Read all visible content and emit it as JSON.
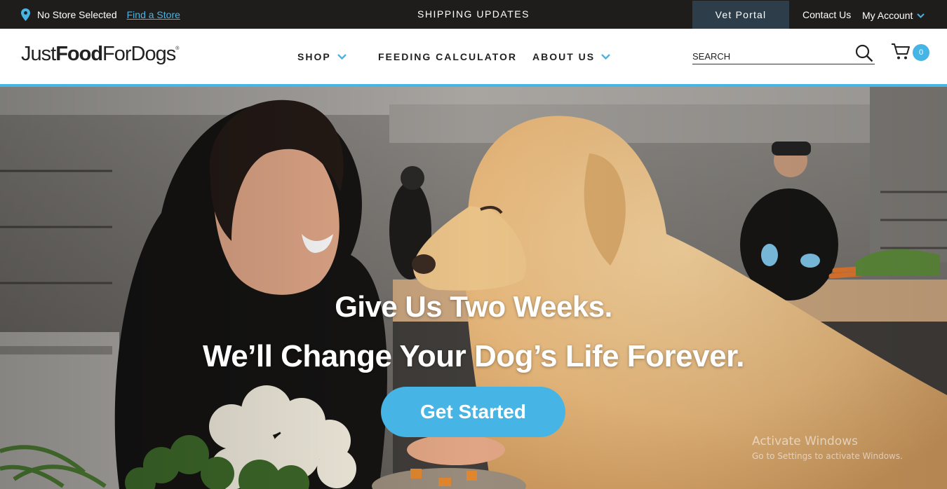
{
  "topbar": {
    "store_status": "No Store Selected",
    "find_store_link": "Find a Store",
    "shipping_updates": "SHIPPING UPDATES",
    "vet_portal": "Vet Portal",
    "contact_us": "Contact Us",
    "my_account": "My Account"
  },
  "header": {
    "logo": {
      "part1": "Just",
      "part2": "Food",
      "part3": "ForDogs",
      "mark": "®"
    },
    "nav": [
      {
        "label": "SHOP",
        "has_dropdown": true
      },
      {
        "label": "FEEDING CALCULATOR",
        "has_dropdown": false
      },
      {
        "label": "ABOUT US",
        "has_dropdown": true
      }
    ],
    "search": {
      "placeholder": "SEARCH",
      "value": ""
    },
    "cart": {
      "count": "0"
    }
  },
  "hero": {
    "headline": "Give Us Two Weeks.",
    "subheadline": "We’ll Change Your Dog’s Life Forever.",
    "cta_label": "Get Started"
  },
  "watermark": {
    "line1": "Activate Windows",
    "line2": "Go to Settings to activate Windows."
  },
  "colors": {
    "accent": "#46b5e5",
    "topbar_bg": "#1f1d1b",
    "vet_portal_bg": "#2d3d4a"
  },
  "icons": [
    "map-pin-icon",
    "chevron-down-icon",
    "search-icon",
    "cart-icon"
  ]
}
